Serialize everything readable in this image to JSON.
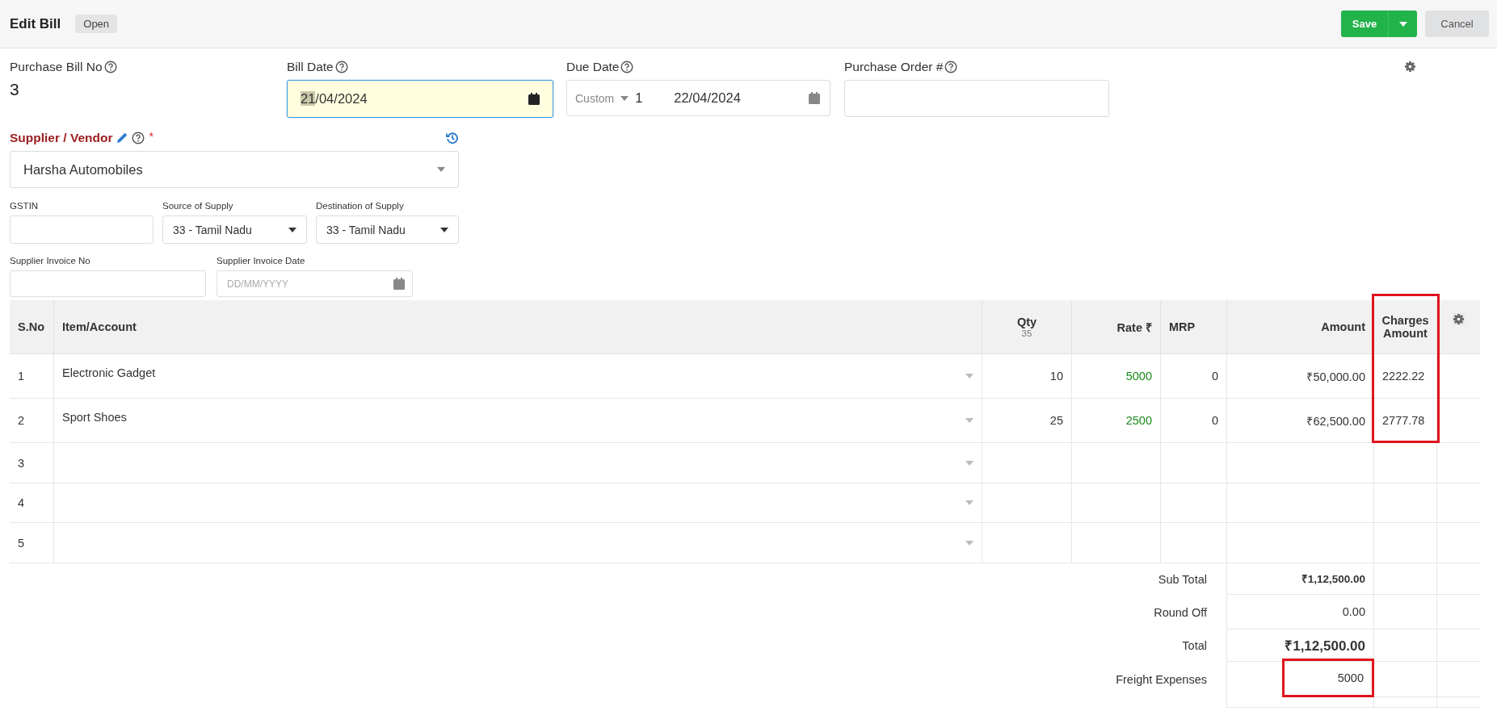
{
  "header": {
    "title": "Edit Bill",
    "status": "Open",
    "buttons": [
      {
        "label": "Save",
        "kind": "primary"
      },
      {
        "label": "Cancel",
        "kind": "secondary"
      }
    ]
  },
  "bill_no": {
    "label": "Purchase Bill No",
    "value": "3"
  },
  "bill_date": {
    "label": "Bill Date",
    "selection": "21",
    "value_after": "/04/2024",
    "focused": true
  },
  "due_date": {
    "label": "Due Date",
    "term": "Custom",
    "days": "1",
    "value": "22/04/2024"
  },
  "purchase_order": {
    "label": "Purchase Order #"
  },
  "supplier": {
    "label": "Supplier / Vendor",
    "required": true,
    "required_mark": "*",
    "value": "Harsha Automobiles"
  },
  "gstin": {
    "label": "GSTIN"
  },
  "source_of_supply": {
    "label": "Source of Supply",
    "value": "33 - Tamil Nadu"
  },
  "destination_of_supply": {
    "label": "Destination of Supply",
    "value": "33 - Tamil Nadu"
  },
  "supplier_invoice_no": {
    "label": "Supplier Invoice No"
  },
  "supplier_invoice_date": {
    "label": "Supplier Invoice Date",
    "placeholder": "DD/MM/YYYY"
  },
  "table": {
    "columns": [
      {
        "label": "S.No",
        "highlighted": false
      },
      {
        "label": "Item/Account",
        "highlighted": false
      },
      {
        "label": "Qty",
        "sub": "35",
        "highlighted": false
      },
      {
        "label": "Rate ₹",
        "highlighted": false
      },
      {
        "label": "MRP",
        "highlighted": false
      },
      {
        "label": "Amount",
        "highlighted": false
      },
      {
        "label": "Charges Amount",
        "highlighted": true
      }
    ],
    "rows": [
      {
        "sno": "1",
        "item": "Electronic Gadget",
        "qty": "10",
        "rate": "5000",
        "mrp": "0",
        "amount": "₹50,000.00",
        "charges": "2222.22"
      },
      {
        "sno": "2",
        "item": "Sport Shoes",
        "qty": "25",
        "rate": "2500",
        "mrp": "0",
        "amount": "₹62,500.00",
        "charges": "2777.78"
      },
      {
        "sno": "3"
      },
      {
        "sno": "4"
      },
      {
        "sno": "5"
      }
    ],
    "totals": [
      {
        "label": "Sub Total",
        "value": "₹1,12,500.00",
        "kind": "subtotal",
        "highlighted": false
      },
      {
        "label": "Round Off",
        "value": "0.00",
        "kind": "plain",
        "highlighted": false
      },
      {
        "label": "Total",
        "value": "₹1,12,500.00",
        "kind": "total",
        "highlighted": false
      },
      {
        "label": "Freight Expenses",
        "value": "5000",
        "kind": "plain",
        "highlighted": true
      }
    ]
  }
}
